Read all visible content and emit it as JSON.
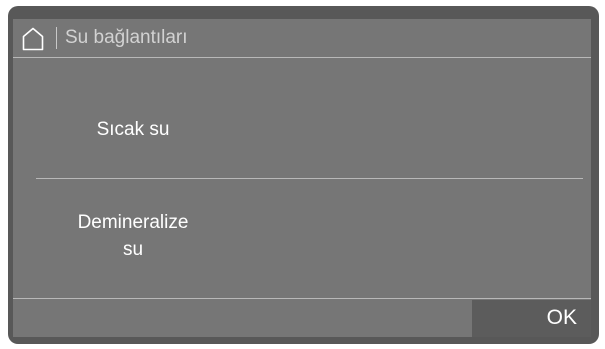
{
  "header": {
    "home_icon": "home-icon",
    "title": "Su bağlantıları"
  },
  "options": [
    {
      "label": "Sıcak su"
    },
    {
      "label_line1": "Demineralize",
      "label_line2": "su"
    }
  ],
  "footer": {
    "ok_label": "OK"
  },
  "colors": {
    "bezel": "#585858",
    "screen_background": "#767676",
    "divider": "#b8b8b8",
    "ok_button_background": "#5c5c5c",
    "text": "#ffffff",
    "header_text": "#d2d2d2"
  }
}
